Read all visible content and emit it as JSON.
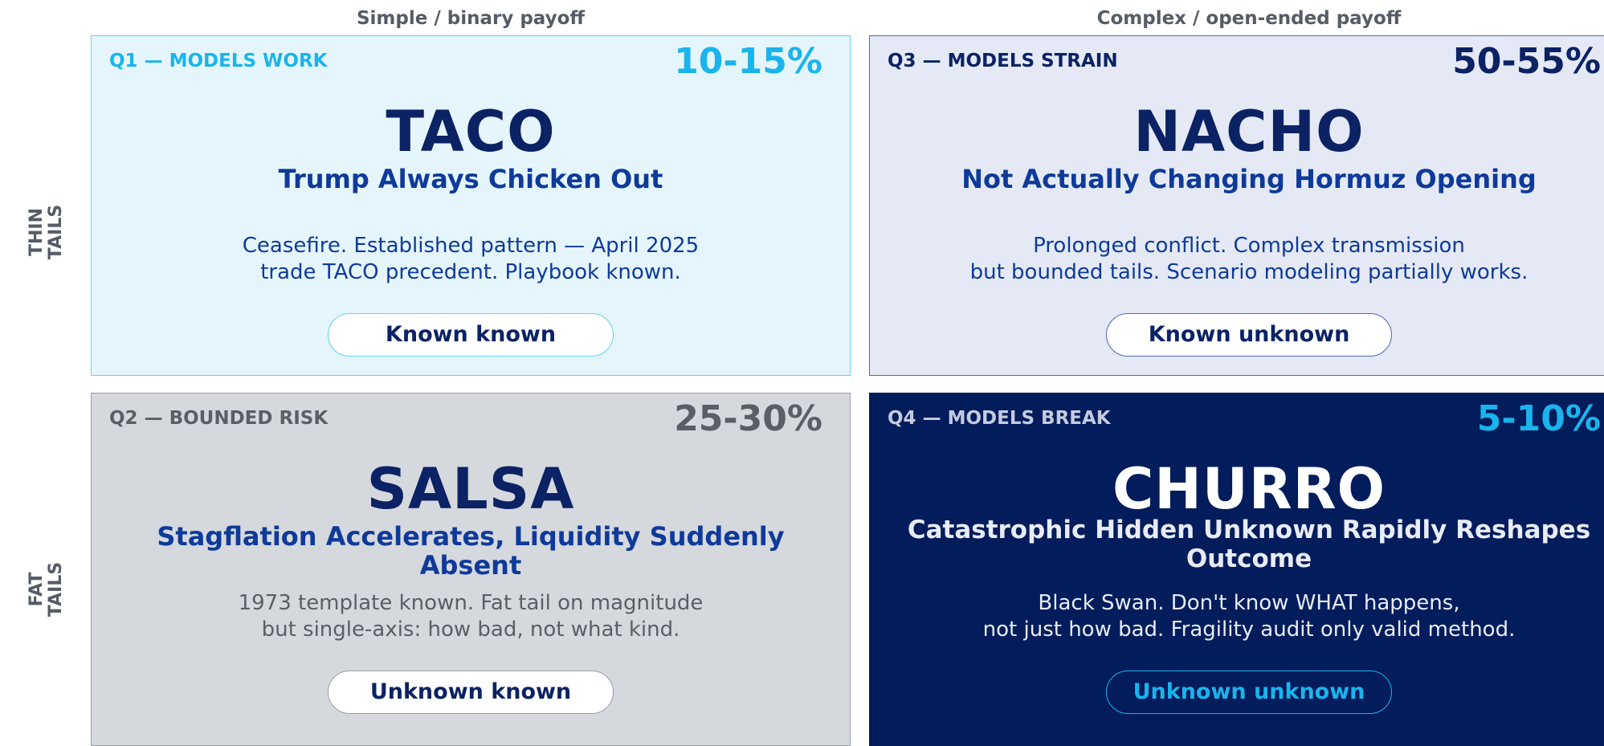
{
  "columns": {
    "left": "Simple / binary payoff",
    "right": "Complex / open-ended payoff"
  },
  "rows": {
    "top": "THIN\nTAILS",
    "bottom": "FAT\nTAILS"
  },
  "quadrants": {
    "q1": {
      "tag": "Q1 — MODELS WORK",
      "percent": "10-15%",
      "acronym": "TACO",
      "full": "Trump Always Chicken Out",
      "description": "Ceasefire. Established pattern — April 2025\ntrade TACO precedent. Playbook known.",
      "pill": "Known known"
    },
    "q3": {
      "tag": "Q3 — MODELS STRAIN",
      "percent": "50-55%",
      "acronym": "NACHO",
      "full": "Not Actually Changing Hormuz Opening",
      "description": "Prolonged conflict. Complex transmission\nbut bounded tails. Scenario modeling partially works.",
      "pill": "Known unknown"
    },
    "q2": {
      "tag": "Q2 — BOUNDED RISK",
      "percent": "25-30%",
      "acronym": "SALSA",
      "full": "Stagflation Accelerates, Liquidity Suddenly Absent",
      "description": "1973 template known. Fat tail on magnitude\nbut single-axis: how bad, not what kind.",
      "pill": "Unknown known"
    },
    "q4": {
      "tag": "Q4 — MODELS BREAK",
      "percent": "5-10%",
      "acronym": "CHURRO",
      "full": "Catastrophic Hidden Unknown Rapidly Reshapes Outcome",
      "description": "Black Swan. Don't know WHAT happens,\nnot just how bad. Fragility audit only valid method.",
      "pill": "Unknown unknown"
    }
  },
  "colors": {
    "q1_bg": "#e5f5fc",
    "q1_border": "#5fd4f0",
    "q1_accent": "#1ab4ec",
    "q3_bg": "#e4e9f5",
    "q3_border": "#5068b4",
    "q2_bg": "#d5d8dd",
    "q2_border": "#9a9ea6",
    "q2_muted": "#5a5e66",
    "q4_bg": "#021c5c",
    "navy": "#0b2264",
    "blue": "#0e3a9a",
    "cyan": "#1ab4ec"
  }
}
